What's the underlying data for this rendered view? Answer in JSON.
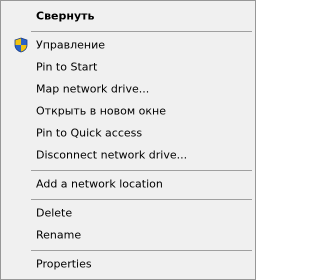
{
  "menu": {
    "items": [
      {
        "id": "collapse",
        "label": "Свернуть",
        "bold": true
      },
      {
        "id": "manage",
        "label": "Управление",
        "icon": "shield-icon",
        "icon_colors": [
          "#1f5ac6",
          "#f4c20d"
        ]
      },
      {
        "id": "pin-to-start",
        "label": "Pin to Start"
      },
      {
        "id": "map-network-drive",
        "label": "Map network drive..."
      },
      {
        "id": "open-new-window",
        "label": "Открыть в новом окне"
      },
      {
        "id": "pin-quick-access",
        "label": "Pin to Quick access"
      },
      {
        "id": "disconnect-network-drive",
        "label": "Disconnect network drive..."
      },
      {
        "id": "add-network-location",
        "label": "Add a network location"
      },
      {
        "id": "delete",
        "label": "Delete"
      },
      {
        "id": "rename",
        "label": "Rename"
      },
      {
        "id": "properties",
        "label": "Properties"
      }
    ]
  }
}
